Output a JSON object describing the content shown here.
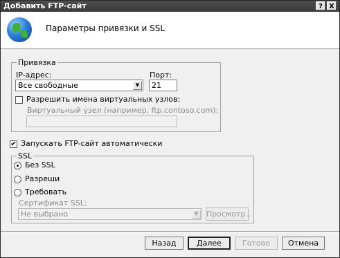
{
  "window": {
    "title": "Добавить FTP-сайт",
    "help_glyph": "?",
    "close_glyph": "X"
  },
  "header": {
    "title": "Параметры привязки и SSL"
  },
  "binding": {
    "legend": "Привязка",
    "ip_label": "IP-адрес:",
    "ip_value": "Все свободные",
    "port_label": "Порт:",
    "port_value": "21",
    "virtual_host_checkbox_label": "Разрешить имена виртуальных узлов:",
    "virtual_host_checked": false,
    "virtual_host_label": "Виртуальный узел (например, ftp.contoso.com):",
    "virtual_host_value": ""
  },
  "autostart": {
    "label": "Запускать FTP-сайт автоматически",
    "checked": true,
    "check_glyph": "✔"
  },
  "ssl": {
    "legend": "SSL",
    "options": [
      "Без SSL",
      "Разреши",
      "Требовать"
    ],
    "selected_index": 0,
    "certificate_label": "Сертификат SSL:",
    "certificate_value": "Не выбрано",
    "view_button": "Просмотр..."
  },
  "footer": {
    "back": "Назад",
    "next": "Далее",
    "finish": "Готово",
    "cancel": "Отмена"
  },
  "icons": {
    "dropdown_arrow": "▼"
  }
}
